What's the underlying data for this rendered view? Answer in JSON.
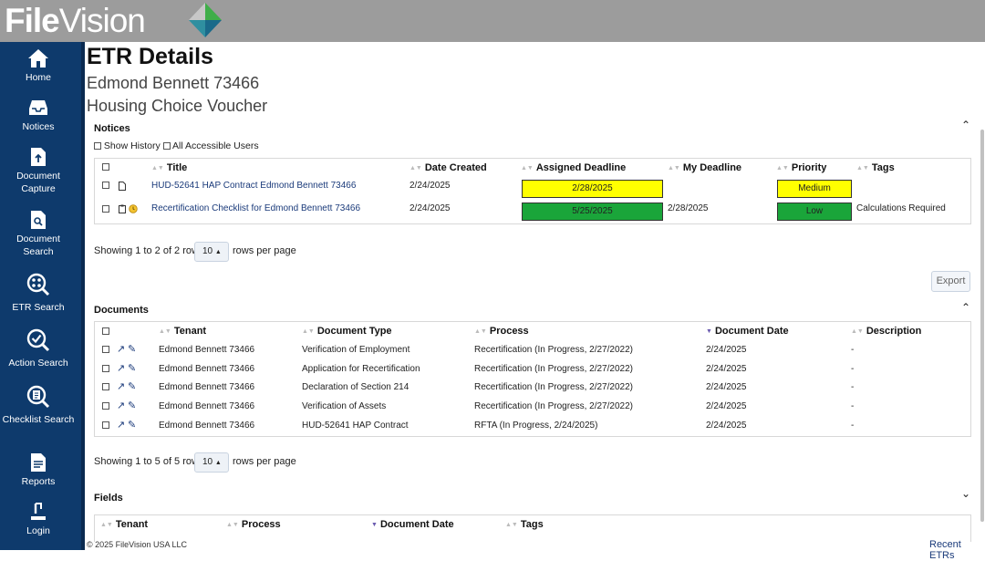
{
  "brand": {
    "name_part1": "File",
    "name_part2": "Vision"
  },
  "sidebar": {
    "items": [
      {
        "label": "Home"
      },
      {
        "label": "Notices"
      },
      {
        "label": "Document Capture"
      },
      {
        "label": "Document Search"
      },
      {
        "label": "ETR Search"
      },
      {
        "label": "Action Search"
      },
      {
        "label": "Checklist Search"
      },
      {
        "label": "Reports"
      },
      {
        "label": "Login"
      }
    ]
  },
  "page": {
    "title": "ETR Details",
    "subject": "Edmond Bennett 73466",
    "program": "Housing Choice Voucher"
  },
  "notices": {
    "section_title": "Notices",
    "show_history_label": "Show History",
    "all_users_label": "All Accessible Users",
    "columns": [
      "Title",
      "Date Created",
      "Assigned Deadline",
      "My Deadline",
      "Priority",
      "Tags"
    ],
    "rows": [
      {
        "title": "HUD-52641 HAP Contract Edmond Bennett 73466",
        "date_created": "2/24/2025",
        "assigned_deadline": "2/28/2025",
        "my_deadline": "",
        "priority": "Medium",
        "tags": ""
      },
      {
        "title": "Recertification Checklist for Edmond Bennett 73466",
        "date_created": "2/24/2025",
        "assigned_deadline": "5/25/2025",
        "my_deadline": "2/28/2025",
        "priority": "Low",
        "tags": "Calculations Required"
      }
    ],
    "pager_text": "Showing 1 to 2 of 2 rows",
    "page_size": "10",
    "rows_per_page": "rows per page",
    "export_label": "Export"
  },
  "documents": {
    "section_title": "Documents",
    "columns": [
      "Tenant",
      "Document Type",
      "Process",
      "Document Date",
      "Description"
    ],
    "rows": [
      {
        "tenant": "Edmond Bennett 73466",
        "type": "Verification of Employment",
        "process": "Recertification (In Progress, 2/27/2022)",
        "date": "2/24/2025",
        "desc": "-"
      },
      {
        "tenant": "Edmond Bennett 73466",
        "type": "Application for Recertification",
        "process": "Recertification (In Progress, 2/27/2022)",
        "date": "2/24/2025",
        "desc": "-"
      },
      {
        "tenant": "Edmond Bennett 73466",
        "type": "Declaration of Section 214",
        "process": "Recertification (In Progress, 2/27/2022)",
        "date": "2/24/2025",
        "desc": "-"
      },
      {
        "tenant": "Edmond Bennett 73466",
        "type": "Verification of Assets",
        "process": "Recertification (In Progress, 2/27/2022)",
        "date": "2/24/2025",
        "desc": "-"
      },
      {
        "tenant": "Edmond Bennett 73466",
        "type": "HUD-52641 HAP Contract",
        "process": "RFTA (In Progress, 2/24/2025)",
        "date": "2/24/2025",
        "desc": "-"
      }
    ],
    "pager_text": "Showing 1 to 5 of 5 rows",
    "page_size": "10",
    "rows_per_page": "rows per page"
  },
  "fields": {
    "section_title": "Fields",
    "columns": [
      "Tenant",
      "Process",
      "Document Date",
      "Tags"
    ]
  },
  "footer": {
    "copyright": "© 2025 FileVision USA LLC",
    "recent_etrs": "Recent ETRs"
  },
  "colors": {
    "nav_bg": "#0e3a6c",
    "topbar": "#9c9c9c",
    "medium": "#ffff00",
    "low": "#1aa53a"
  }
}
